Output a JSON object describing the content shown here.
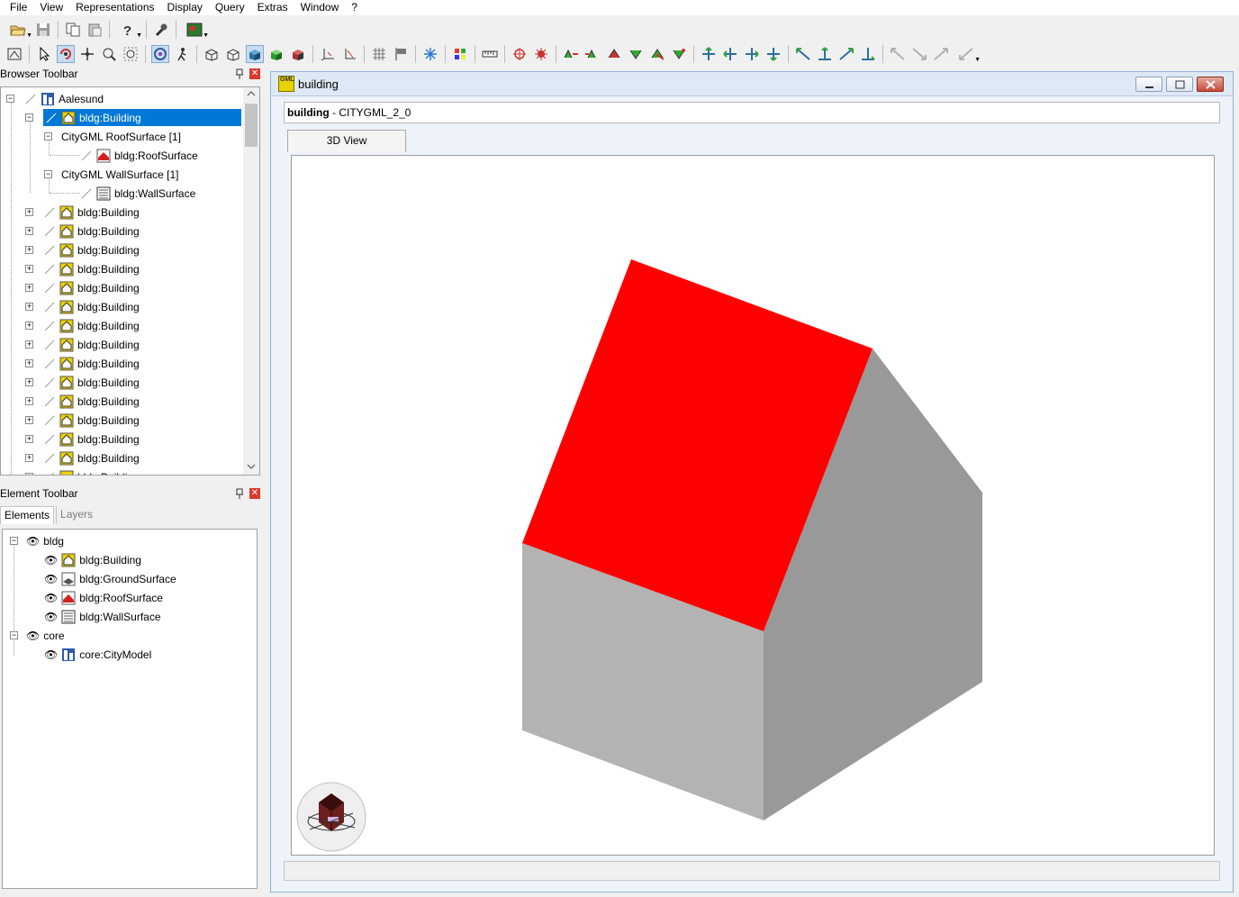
{
  "menu": [
    "File",
    "View",
    "Representations",
    "Display",
    "Query",
    "Extras",
    "Window",
    "?"
  ],
  "browser_panel": {
    "title": "Browser Toolbar",
    "root_label": "Aalesund",
    "selected_label": "bldg:Building",
    "roof_group": "CityGML RoofSurface [1]",
    "roof_item": "bldg:RoofSurface",
    "wall_group": "CityGML WallSurface [1]",
    "wall_item": "bldg:WallSurface",
    "buildings": [
      "bldg:Building",
      "bldg:Building",
      "bldg:Building",
      "bldg:Building",
      "bldg:Building",
      "bldg:Building",
      "bldg:Building",
      "bldg:Building",
      "bldg:Building",
      "bldg:Building",
      "bldg:Building",
      "bldg:Building",
      "bldg:Building",
      "bldg:Building"
    ],
    "partial_label": "bldg:Building"
  },
  "element_panel": {
    "title": "Element Toolbar",
    "tabs": [
      "Elements",
      "Layers"
    ],
    "groups": [
      {
        "label": "bldg",
        "items": [
          "bldg:Building",
          "bldg:GroundSurface",
          "bldg:RoofSurface",
          "bldg:WallSurface"
        ]
      },
      {
        "label": "core",
        "items": [
          "core:CityModel"
        ]
      }
    ]
  },
  "document": {
    "title": "building",
    "header_bold": "building",
    "header_rest": " - CITYGML_2_0",
    "tab": "3D View",
    "icon_text": "GML"
  },
  "colors": {
    "selection": "#0078d7",
    "roof": "#ff0000",
    "wall_front": "#b3b3b3",
    "wall_side": "#999999",
    "building_icon": "#e8d200"
  }
}
